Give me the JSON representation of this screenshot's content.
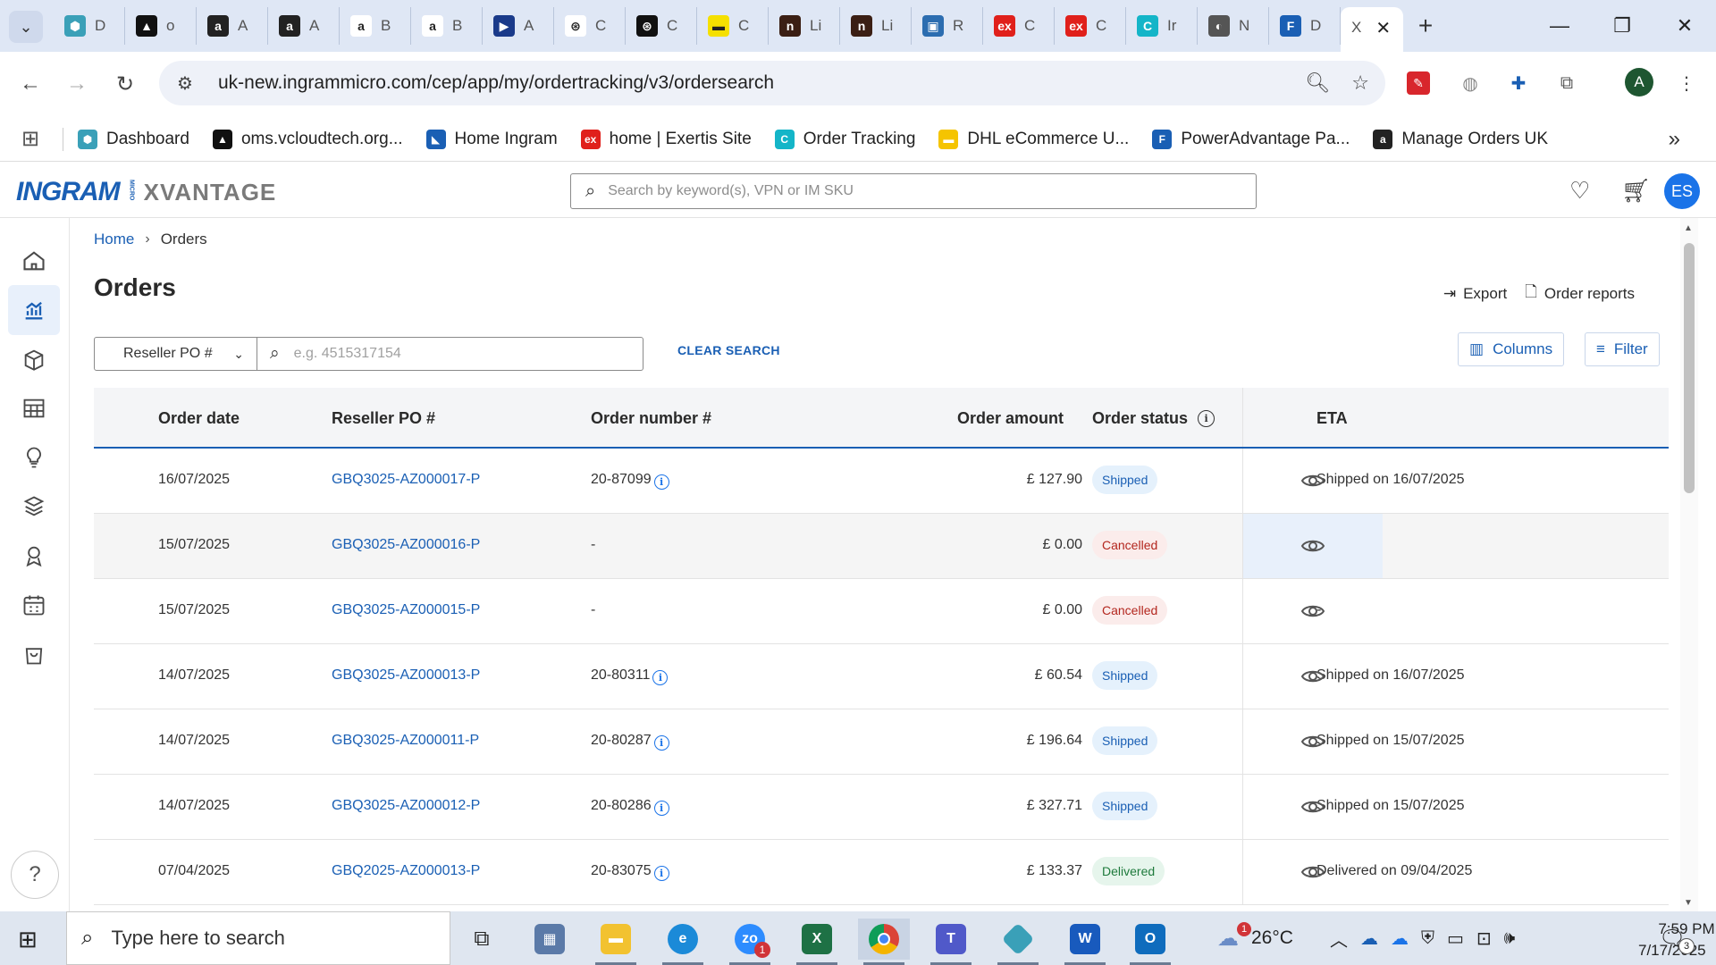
{
  "browser": {
    "tabs": [
      {
        "letter": "D",
        "color": "#3aa0b8",
        "glyph": "⬢"
      },
      {
        "letter": "o",
        "color": "#111",
        "glyph": "▲"
      },
      {
        "letter": "A",
        "color": "#222",
        "glyph": "a"
      },
      {
        "letter": "A",
        "color": "#222",
        "glyph": "a"
      },
      {
        "letter": "B",
        "color": "#fff",
        "glyph": "a"
      },
      {
        "letter": "B",
        "color": "#fff",
        "glyph": "a"
      },
      {
        "letter": "A",
        "color": "#1a3a8a",
        "glyph": "▶"
      },
      {
        "letter": "C",
        "color": "#fff",
        "glyph": "⊛"
      },
      {
        "letter": "C",
        "color": "#111",
        "glyph": "⊛"
      },
      {
        "letter": "C",
        "color": "#f5e000",
        "glyph": "▬"
      },
      {
        "letter": "Li",
        "color": "#3b1f14",
        "glyph": "n"
      },
      {
        "letter": "Li",
        "color": "#3b1f14",
        "glyph": "n"
      },
      {
        "letter": "R",
        "color": "#2c6db0",
        "glyph": "▣"
      },
      {
        "letter": "C",
        "color": "#e0201b",
        "glyph": "ex"
      },
      {
        "letter": "C",
        "color": "#e0201b",
        "glyph": "ex"
      },
      {
        "letter": "Ir",
        "color": "#14b5c8",
        "glyph": "C"
      },
      {
        "letter": "N",
        "color": "#555",
        "glyph": "◐"
      },
      {
        "letter": "D",
        "color": "#1a5fb4",
        "glyph": "F"
      }
    ],
    "active_tab_label": "X",
    "url": "uk-new.ingrammicro.com/cep/app/my/ordertracking/v3/ordersearch",
    "profile_initial": "A",
    "bookmarks": [
      {
        "label": "Dashboard",
        "color": "#3aa0b8",
        "glyph": "⬢"
      },
      {
        "label": "oms.vcloudtech.org...",
        "color": "#111",
        "glyph": "▲"
      },
      {
        "label": "Home Ingram",
        "color": "#1a5fb4",
        "glyph": "◣"
      },
      {
        "label": "home | Exertis Site",
        "color": "#e0201b",
        "glyph": "ex"
      },
      {
        "label": "Order Tracking",
        "color": "#14b5c8",
        "glyph": "C"
      },
      {
        "label": "DHL eCommerce U...",
        "color": "#f5c400",
        "glyph": "▬"
      },
      {
        "label": "PowerAdvantage Pa...",
        "color": "#1a5fb4",
        "glyph": "F"
      },
      {
        "label": "Manage Orders UK",
        "color": "#222",
        "glyph": "a"
      }
    ]
  },
  "header": {
    "logo_ingram": "INGRAM",
    "logo_micro": "MICRO",
    "logo_xvantage": "XVANTAGE",
    "search_placeholder": "Search by keyword(s), VPN or IM SKU",
    "user_initials": "ES"
  },
  "breadcrumb": {
    "home": "Home",
    "current": "Orders"
  },
  "page": {
    "title": "Orders",
    "export_label": "Export",
    "order_reports_label": "Order reports",
    "search_type_value": "Reseller PO #",
    "search_placeholder": "e.g. 4515317154",
    "clear_search_label": "CLEAR SEARCH",
    "columns_label": "Columns",
    "filter_label": "Filter"
  },
  "table": {
    "headers": {
      "order_date": "Order date",
      "reseller_po": "Reseller PO #",
      "order_number": "Order number #",
      "order_amount": "Order amount",
      "order_status": "Order status",
      "eta": "ETA"
    },
    "rows": [
      {
        "date": "16/07/2025",
        "po": "GBQ3025-AZ000017-P",
        "order_number": "20-87099",
        "has_info": true,
        "amount": "£ 127.90",
        "status": "Shipped",
        "status_type": "shipped",
        "eta": "Shipped on 16/07/2025"
      },
      {
        "date": "15/07/2025",
        "po": "GBQ3025-AZ000016-P",
        "order_number": "-",
        "has_info": false,
        "amount": "£ 0.00",
        "status": "Cancelled",
        "status_type": "cancelled",
        "eta": "-"
      },
      {
        "date": "15/07/2025",
        "po": "GBQ3025-AZ000015-P",
        "order_number": "-",
        "has_info": false,
        "amount": "£ 0.00",
        "status": "Cancelled",
        "status_type": "cancelled",
        "eta": "-"
      },
      {
        "date": "14/07/2025",
        "po": "GBQ3025-AZ000013-P",
        "order_number": "20-80311",
        "has_info": true,
        "amount": "£ 60.54",
        "status": "Shipped",
        "status_type": "shipped",
        "eta": "Shipped on 16/07/2025"
      },
      {
        "date": "14/07/2025",
        "po": "GBQ3025-AZ000011-P",
        "order_number": "20-80287",
        "has_info": true,
        "amount": "£ 196.64",
        "status": "Shipped",
        "status_type": "shipped",
        "eta": "Shipped on 15/07/2025"
      },
      {
        "date": "14/07/2025",
        "po": "GBQ3025-AZ000012-P",
        "order_number": "20-80286",
        "has_info": true,
        "amount": "£ 327.71",
        "status": "Shipped",
        "status_type": "shipped",
        "eta": "Shipped on 15/07/2025"
      },
      {
        "date": "07/04/2025",
        "po": "GBQ2025-AZ000013-P",
        "order_number": "20-83075",
        "has_info": true,
        "amount": "£ 133.37",
        "status": "Delivered",
        "status_type": "delivered",
        "eta": "Delivered on 09/04/2025"
      }
    ]
  },
  "taskbar": {
    "search_placeholder": "Type here to search",
    "weather": "26°C",
    "weather_badge": "1",
    "zoom_badge": "1",
    "time": "7:59 PM",
    "date": "7/17/2025",
    "notification_count": "3"
  }
}
